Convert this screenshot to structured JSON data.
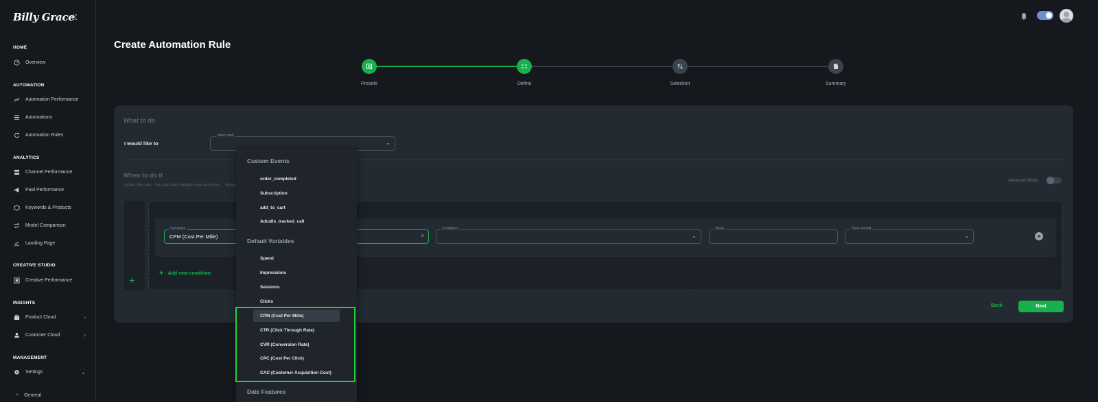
{
  "sidebar": {
    "logo": "Billy Grace",
    "sections": {
      "home": "HOME",
      "automation": "AUTOMATION",
      "analytics": "ANALYTICS",
      "creative": "CREATIVE STUDIO",
      "insights": "INSIGHTS",
      "management": "MANAGEMENT"
    },
    "items": {
      "overview": "Overview",
      "automation_performance": "Automation Performance",
      "automations": "Automations",
      "automation_rules": "Automation Rules",
      "channel_performance": "Channel Performance",
      "paid_performance": "Paid Performance",
      "keywords_products": "Keywords & Products",
      "model_comparison": "Model Comparison",
      "landing_page": "Landing Page",
      "creative_performance": "Creative Performance",
      "product_cloud": "Product Cloud",
      "customer_cloud": "Customer Cloud",
      "settings": "Settings",
      "general": "General"
    }
  },
  "page": {
    "title": "Create Automation Rule"
  },
  "stepper": {
    "steps": [
      "Presets",
      "Define",
      "Selection",
      "Summary"
    ]
  },
  "form": {
    "what_title": "What to do",
    "like_label": "I would like to",
    "task_legend": "select task",
    "when_title": "When to do it",
    "description": "Define the rules. You can add multiple rules and how ... should be true, AND -all rules should be true.",
    "advanced_mode": "Advanced Mode",
    "variables_legend": "Variables",
    "variables_value": "CPM (Cost Per Mille)",
    "condition_legend": "Condition",
    "value_legend": "Value",
    "time_period_legend": "Time Period",
    "add_condition": "Add new condition",
    "back": "Back",
    "next": "Next"
  },
  "dropdown": {
    "custom_events_header": "Custom Events",
    "custom_events": [
      "order_completed",
      "Subscription",
      "add_to_cart",
      "Adcalls_tracked_call"
    ],
    "default_variables_header": "Default Variables",
    "default_variables": [
      "Spend",
      "Impressions",
      "Sessions",
      "Clicks",
      "CPM (Cost Per Mille)",
      "CTR (Click Through Rate)",
      "CVR (Conversion Rate)",
      "CPC (Cost Per Click)",
      "CAC (Customer Acquisition Cost)"
    ],
    "date_features_header": "Date Features",
    "highlighted": "CPM (Cost Per Mille)"
  },
  "colors": {
    "accent": "#17b04d",
    "highlight_box": "#22d13a",
    "background": "#15191e",
    "card": "#232a31"
  }
}
